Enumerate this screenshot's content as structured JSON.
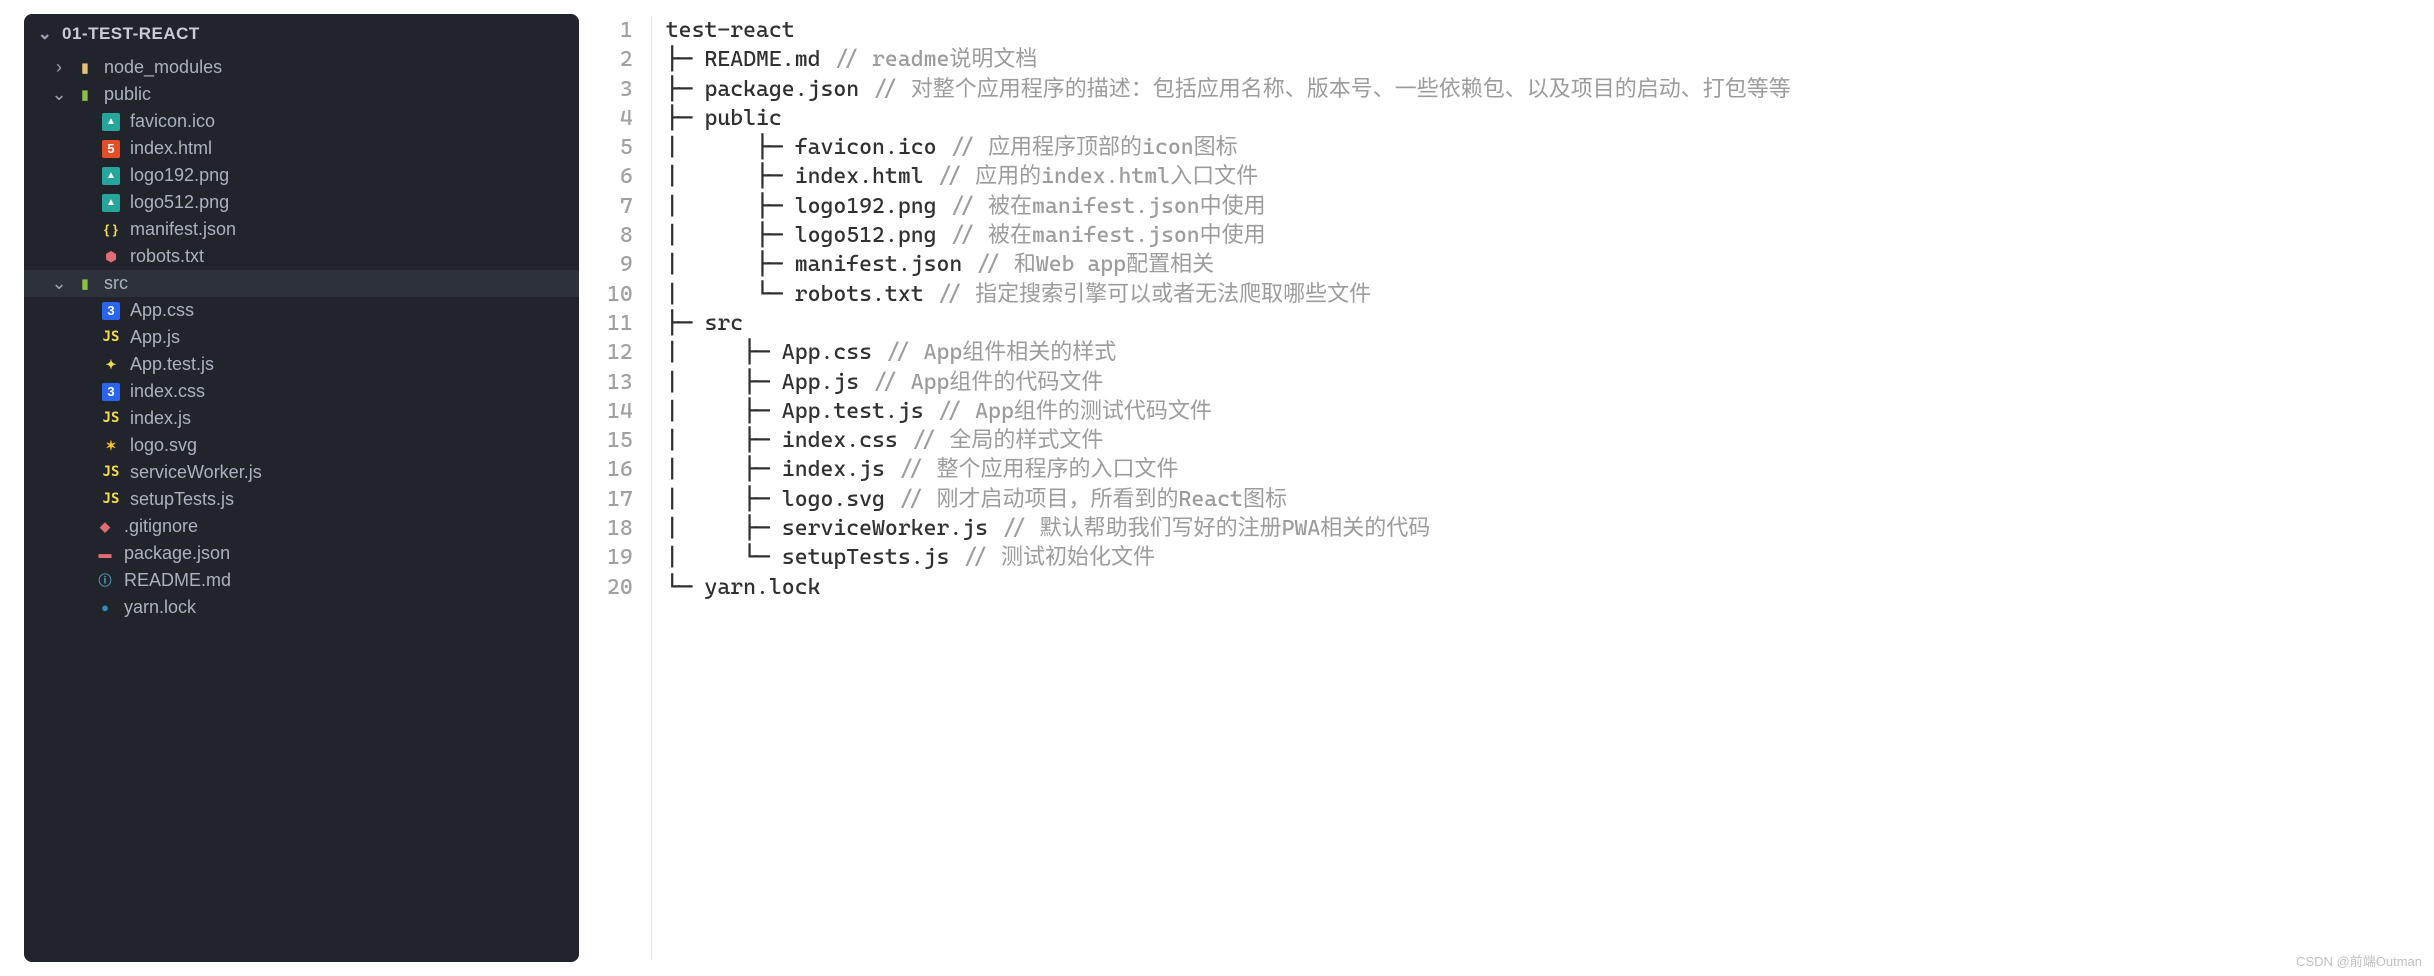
{
  "explorer": {
    "project": "01-TEST-REACT",
    "tree": [
      {
        "type": "dir",
        "open": false,
        "depth": 0,
        "name": "node_modules",
        "icon": "folder",
        "chev": "right"
      },
      {
        "type": "dir",
        "open": true,
        "depth": 0,
        "name": "public",
        "icon": "folder-open",
        "chev": "down"
      },
      {
        "type": "file",
        "depth": 1,
        "name": "favicon.ico",
        "icon": "img"
      },
      {
        "type": "file",
        "depth": 1,
        "name": "index.html",
        "icon": "html"
      },
      {
        "type": "file",
        "depth": 1,
        "name": "logo192.png",
        "icon": "img"
      },
      {
        "type": "file",
        "depth": 1,
        "name": "logo512.png",
        "icon": "img"
      },
      {
        "type": "file",
        "depth": 1,
        "name": "manifest.json",
        "icon": "json"
      },
      {
        "type": "file",
        "depth": 1,
        "name": "robots.txt",
        "icon": "robot"
      },
      {
        "type": "dir",
        "open": true,
        "depth": 0,
        "name": "src",
        "icon": "folder-open",
        "chev": "down",
        "selected": true
      },
      {
        "type": "file",
        "depth": 1,
        "name": "App.css",
        "icon": "css"
      },
      {
        "type": "file",
        "depth": 1,
        "name": "App.js",
        "icon": "js"
      },
      {
        "type": "file",
        "depth": 1,
        "name": "App.test.js",
        "icon": "test"
      },
      {
        "type": "file",
        "depth": 1,
        "name": "index.css",
        "icon": "css"
      },
      {
        "type": "file",
        "depth": 1,
        "name": "index.js",
        "icon": "js"
      },
      {
        "type": "file",
        "depth": 1,
        "name": "logo.svg",
        "icon": "svg"
      },
      {
        "type": "file",
        "depth": 1,
        "name": "serviceWorker.js",
        "icon": "js"
      },
      {
        "type": "file",
        "depth": 1,
        "name": "setupTests.js",
        "icon": "js"
      },
      {
        "type": "file",
        "depth": "r",
        "name": ".gitignore",
        "icon": "git"
      },
      {
        "type": "file",
        "depth": "r",
        "name": "package.json",
        "icon": "json-red"
      },
      {
        "type": "file",
        "depth": "r",
        "name": "README.md",
        "icon": "md"
      },
      {
        "type": "file",
        "depth": "r",
        "name": "yarn.lock",
        "icon": "yarn"
      }
    ]
  },
  "editor": {
    "lines": [
      {
        "n": 1,
        "text": "test-react"
      },
      {
        "n": 2,
        "text": "├─ README.md // readme说明文档"
      },
      {
        "n": 3,
        "text": "├─ package.json // 对整个应用程序的描述：包括应用名称、版本号、一些依赖包、以及项目的启动、打包等等"
      },
      {
        "n": 4,
        "text": "├─ public"
      },
      {
        "n": 5,
        "text": "|      ├─ favicon.ico // 应用程序顶部的icon图标"
      },
      {
        "n": 6,
        "text": "|      ├─ index.html // 应用的index.html入口文件"
      },
      {
        "n": 7,
        "text": "|      ├─ logo192.png // 被在manifest.json中使用"
      },
      {
        "n": 8,
        "text": "|      ├─ logo512.png // 被在manifest.json中使用"
      },
      {
        "n": 9,
        "text": "|      ├─ manifest.json // 和Web app配置相关"
      },
      {
        "n": 10,
        "text": "|      └─ robots.txt // 指定搜索引擎可以或者无法爬取哪些文件"
      },
      {
        "n": 11,
        "text": "├─ src"
      },
      {
        "n": 12,
        "text": "|     ├─ App.css // App组件相关的样式"
      },
      {
        "n": 13,
        "text": "|     ├─ App.js // App组件的代码文件"
      },
      {
        "n": 14,
        "text": "|     ├─ App.test.js // App组件的测试代码文件"
      },
      {
        "n": 15,
        "text": "|     ├─ index.css // 全局的样式文件"
      },
      {
        "n": 16,
        "text": "|     ├─ index.js // 整个应用程序的入口文件"
      },
      {
        "n": 17,
        "text": "|     ├─ logo.svg // 刚才启动项目，所看到的React图标"
      },
      {
        "n": 18,
        "text": "|     ├─ serviceWorker.js // 默认帮助我们写好的注册PWA相关的代码"
      },
      {
        "n": 19,
        "text": "|     └─ setupTests.js // 测试初始化文件"
      },
      {
        "n": 20,
        "text": "└─ yarn.lock"
      }
    ]
  },
  "watermark": "CSDN @前端Outman"
}
